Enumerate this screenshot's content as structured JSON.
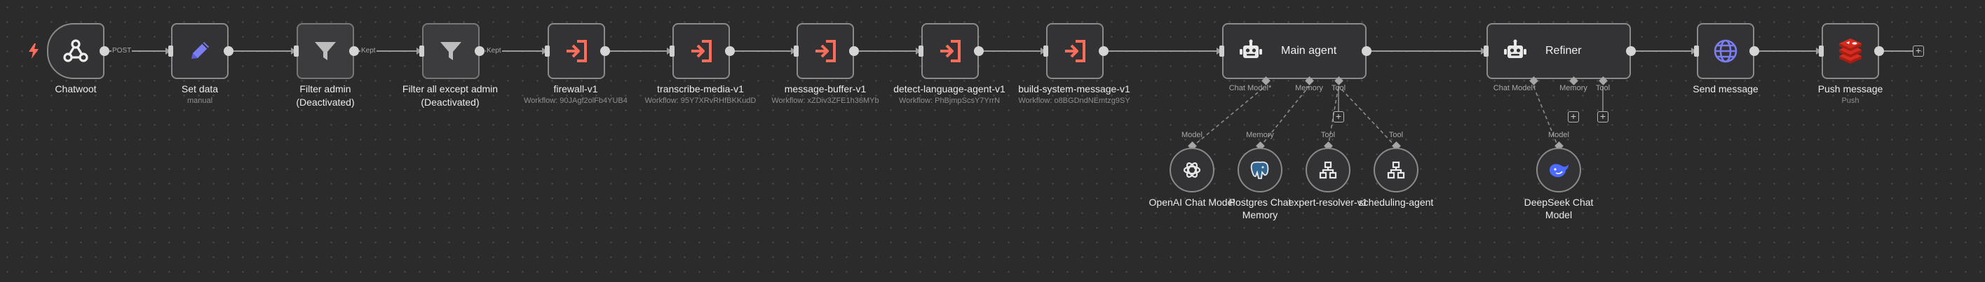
{
  "nodes": {
    "chatwoot": {
      "label": "Chatwoot",
      "edge_label": "POST"
    },
    "set_data": {
      "label": "Set data",
      "sub": "manual"
    },
    "filter_admin": {
      "label": "Filter admin",
      "state": "(Deactivated)",
      "edge_label": "Kept"
    },
    "filter_all": {
      "label": "Filter all except admin",
      "state": "(Deactivated)",
      "edge_label": "Kept"
    },
    "firewall": {
      "label": "firewall-v1",
      "sub": "Workflow: 90JAgf2olFb4YUB4"
    },
    "transcribe": {
      "label": "transcribe-media-v1",
      "sub": "Workflow: 95Y7XRvRHfBKKudD"
    },
    "buffer": {
      "label": "message-buffer-v1",
      "sub": "Workflow: xZDiv3ZFE1h36MYb"
    },
    "detect": {
      "label": "detect-language-agent-v1",
      "sub": "Workflow: PhBjmpScsY7YrrN"
    },
    "build": {
      "label": "build-system-message-v1",
      "sub": "Workflow: o8BGDndNEmtzg9SY"
    },
    "main_agent": {
      "label": "Main agent",
      "handles": [
        "Chat Model*",
        "Memory",
        "Tool"
      ]
    },
    "refiner": {
      "label": "Refiner",
      "handles": [
        "Chat Model*",
        "Memory",
        "Tool"
      ]
    },
    "send": {
      "label": "Send message"
    },
    "push": {
      "label": "Push message",
      "sub": "Push"
    }
  },
  "subnodes": {
    "openai": {
      "label": "OpenAI Chat Model",
      "handle": "Model"
    },
    "postgres": {
      "label": "Postgres Chat Memory",
      "handle": "Memory"
    },
    "expert": {
      "label": "expert-resolver-v1",
      "handle": "Tool"
    },
    "scheduling": {
      "label": "scheduling-agent",
      "handle": "Tool"
    },
    "deepseek": {
      "label": "DeepSeek Chat Model",
      "handle": "Model"
    }
  },
  "add_symbol": "+",
  "colors": {
    "background": "#2b2b2b",
    "node_border": "#8a8a8a",
    "exec_icon": "#ff6d5a",
    "pencil_icon": "#7b7ef0",
    "globe_icon": "#7b7ef0",
    "redis_icon": "#d82c20",
    "deepseek_icon": "#4d6bfe",
    "trigger_icon": "#ff6d5a"
  }
}
